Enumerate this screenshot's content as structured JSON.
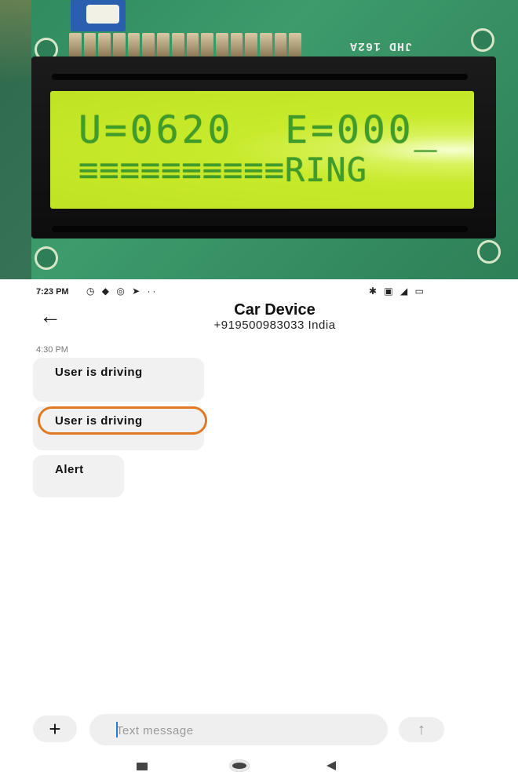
{
  "photo": {
    "lcd_model": "JHD 162A",
    "lcd_line1": "U=0620  E=000_",
    "lcd_line2": "≡≡≡≡≡≡≡≡≡≡RING"
  },
  "statusbar": {
    "time": "7:23 PM",
    "left_icons": "◷ ◆ ◎ ➤ ··",
    "right_icons": "✱ ▣ ◢ ▭"
  },
  "conversation": {
    "contact_name": "Car Device",
    "contact_number": "+919500983033 India",
    "timestamp": "4:30 PM",
    "messages": [
      {
        "text": "User is driving"
      },
      {
        "text": "User is driving",
        "highlighted": true
      },
      {
        "text": "Alert"
      }
    ]
  },
  "compose": {
    "placeholder": "Text message",
    "value": ""
  },
  "colors": {
    "highlight": "#e07a22",
    "bubble": "#f1f1f1",
    "lcd_text": "#3f9b2a",
    "lcd_backlight": "#c8ea2c"
  },
  "icons": {
    "back": "arrow-left-icon",
    "attach": "plus-icon",
    "send": "arrow-up-icon",
    "nav_recents": "square-icon",
    "nav_home": "circle-icon",
    "nav_back": "triangle-left-icon"
  }
}
